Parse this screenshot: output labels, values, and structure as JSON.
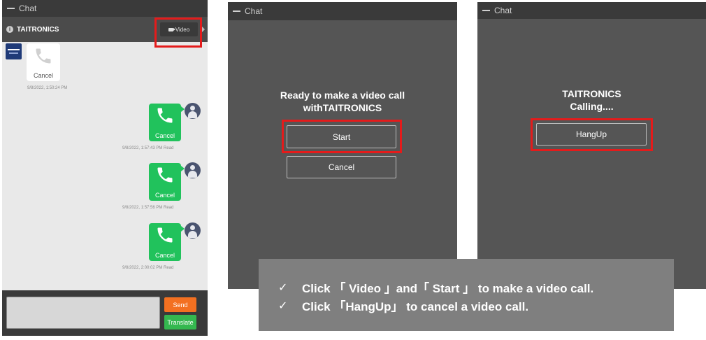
{
  "chat_screen": {
    "window_title": "Chat",
    "contact_name": "TAITRONICS",
    "video_button_label": "Video",
    "messages": [
      {
        "direction": "incoming",
        "label": "Cancel",
        "timestamp": "9/8/2022, 1:50:24 PM"
      },
      {
        "direction": "outgoing",
        "label": "Cancel",
        "timestamp": "9/8/2022, 1:57:43 PM Read"
      },
      {
        "direction": "outgoing",
        "label": "Cancel",
        "timestamp": "9/8/2022, 1:57:56 PM Read"
      },
      {
        "direction": "outgoing",
        "label": "Cancel",
        "timestamp": "9/8/2022, 2:00:02 PM Read"
      }
    ],
    "send_label": "Send",
    "translate_label": "Translate"
  },
  "video_prompt_screen": {
    "window_title": "Chat",
    "message_line1": "Ready to make a video call",
    "message_line2": "withTAITRONICS",
    "start_label": "Start",
    "cancel_label": "Cancel"
  },
  "calling_screen": {
    "window_title": "Chat",
    "contact_name": "TAITRONICS",
    "status": "Calling....",
    "hangup_label": "HangUp"
  },
  "instructions": {
    "line1": "Click 「 Video 」and「 Start 」  to make a video call.",
    "line2": "Click 「HangUp」 to cancel a video call."
  },
  "colors": {
    "highlight": "#e41b1b",
    "call_bubble": "#21c25c",
    "send": "#f37021",
    "translate": "#34b84f"
  }
}
